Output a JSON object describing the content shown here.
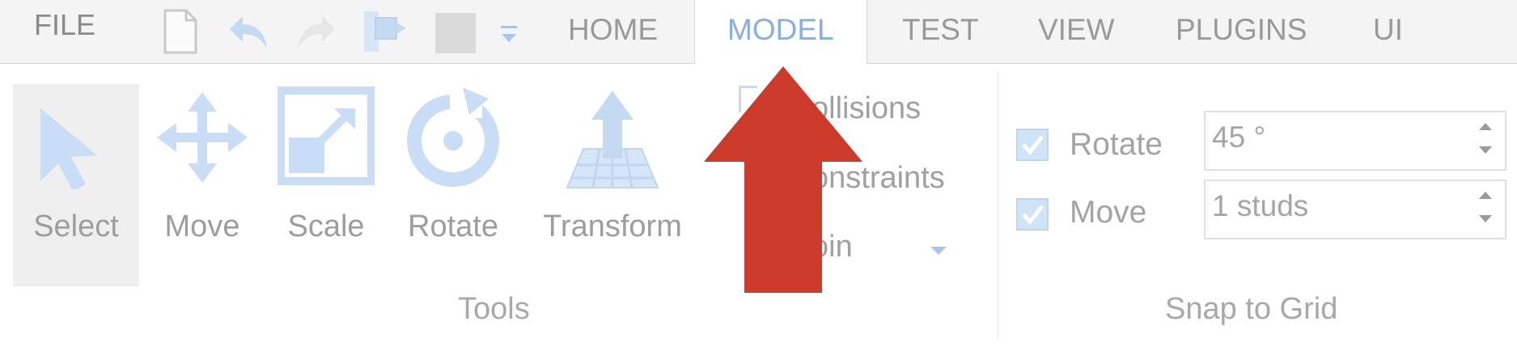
{
  "tabbar": {
    "file_label": "FILE",
    "tabs": [
      "HOME",
      "MODEL",
      "TEST",
      "VIEW",
      "PLUGINS",
      "UI"
    ],
    "active_tab": "MODEL"
  },
  "tools": {
    "items": [
      {
        "label": "Select",
        "icon": "cursor-icon"
      },
      {
        "label": "Move",
        "icon": "move-arrows-icon"
      },
      {
        "label": "Scale",
        "icon": "scale-icon"
      },
      {
        "label": "Rotate",
        "icon": "rotate-icon"
      },
      {
        "label": "Transform",
        "icon": "transform-icon"
      }
    ],
    "group_label": "Tools"
  },
  "options": {
    "collisions_label": "ollisions",
    "constraints_label": "onstraints",
    "join_label": "oin"
  },
  "snap": {
    "rotate_label": "Rotate",
    "rotate_value": "45 °",
    "move_label": "Move",
    "move_value": "1 studs",
    "group_label": "Snap to Grid"
  },
  "colors": {
    "accent": "#88aee6",
    "icon_blue": "#c9ddf6",
    "arrow_red": "#cc3a2a"
  }
}
